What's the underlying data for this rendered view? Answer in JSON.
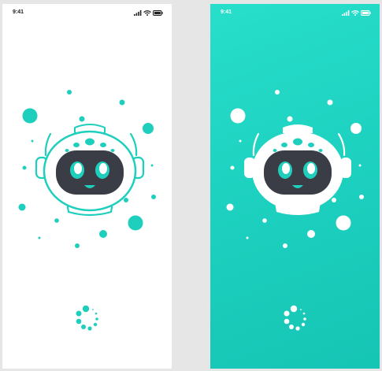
{
  "screens": [
    {
      "id": "light",
      "status_time": "9:41",
      "background": "#ffffff",
      "accent": "#1ecfbd",
      "face_screen": "#3a3d45",
      "icons": [
        "signal-icon",
        "wifi-icon",
        "battery-icon",
        "robot-mascot-icon",
        "loading-spinner-icon"
      ]
    },
    {
      "id": "teal",
      "status_time": "9:41",
      "background": "#1ecfbd",
      "accent": "#ffffff",
      "face_screen": "#3a3d45",
      "icons": [
        "signal-icon",
        "wifi-icon",
        "battery-icon",
        "robot-mascot-icon",
        "loading-spinner-icon"
      ]
    }
  ]
}
